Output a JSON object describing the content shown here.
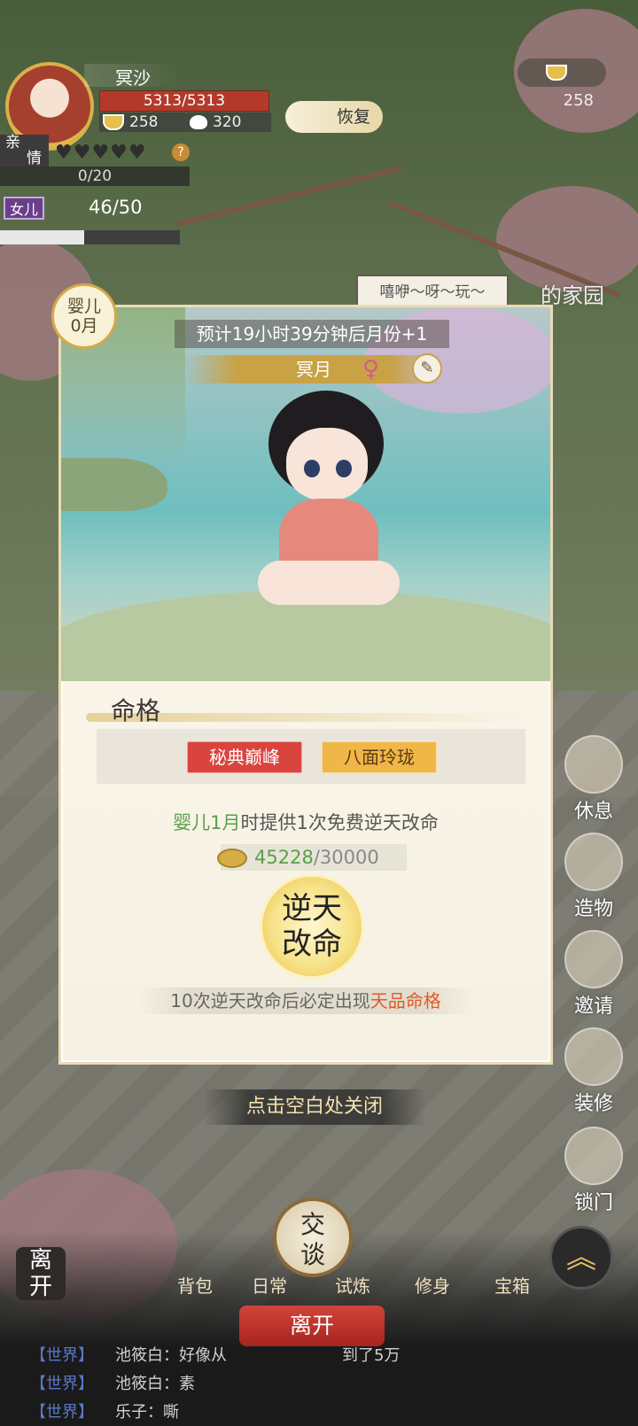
{
  "player": {
    "name": "冥沙",
    "hp": "5313/5313",
    "rice": "258",
    "buns": "320",
    "restore_label": "恢复",
    "bond_label_top": "亲",
    "bond_label_bottom": "情",
    "bond_hearts": "♥♥♥♥♥",
    "bond_progress": "0/20",
    "help": "?",
    "daughter_tag": "女儿",
    "daughter_count": "46/50",
    "daughter_fill_fraction": 0.47
  },
  "top_right": {
    "rice": "258"
  },
  "home": {
    "speech": "嘻咿～呀～玩～",
    "title": "的家园"
  },
  "side_buttons": [
    {
      "label": "休息"
    },
    {
      "label": "造物"
    },
    {
      "label": "邀请"
    },
    {
      "label": "装修"
    },
    {
      "label": "锁门"
    }
  ],
  "modal": {
    "badge_line1": "婴儿",
    "badge_line2": "0月",
    "countdown": "预计19小时39分钟后月份+1",
    "child_name": "冥月",
    "gender_symbol": "♀",
    "brush_icon": "✎",
    "section_title": "命格",
    "traits": [
      {
        "label": "秘典巅峰",
        "color": "#d9443e"
      },
      {
        "label": "八面玲珑",
        "color": "#f0b648"
      }
    ],
    "free_prefix": "婴儿1月",
    "free_suffix": "时提供1次免费逆天改命",
    "cost_have": "45228",
    "cost_need": "/30000",
    "fate_line1": "逆天",
    "fate_line2": "改命",
    "guarantee_prefix": "10次逆天改命后必定出现",
    "guarantee_highlight": "天品命格"
  },
  "close_hint": "点击空白处关闭",
  "bottom_nav": {
    "talk_line1": "交",
    "talk_line2": "谈",
    "leave_side_line1": "离",
    "leave_side_line2": "开",
    "items": [
      "背包",
      "日常",
      "试炼",
      "修身",
      "宝箱"
    ],
    "leave": "离开",
    "up_icon": "︽"
  },
  "chat": [
    {
      "channel": "【世界】",
      "text": "池筱白：好像从",
      "tail": "到了5万"
    },
    {
      "channel": "【世界】",
      "text": "池筱白：素"
    },
    {
      "channel": "【世界】",
      "text": "乐子：嘶"
    }
  ]
}
